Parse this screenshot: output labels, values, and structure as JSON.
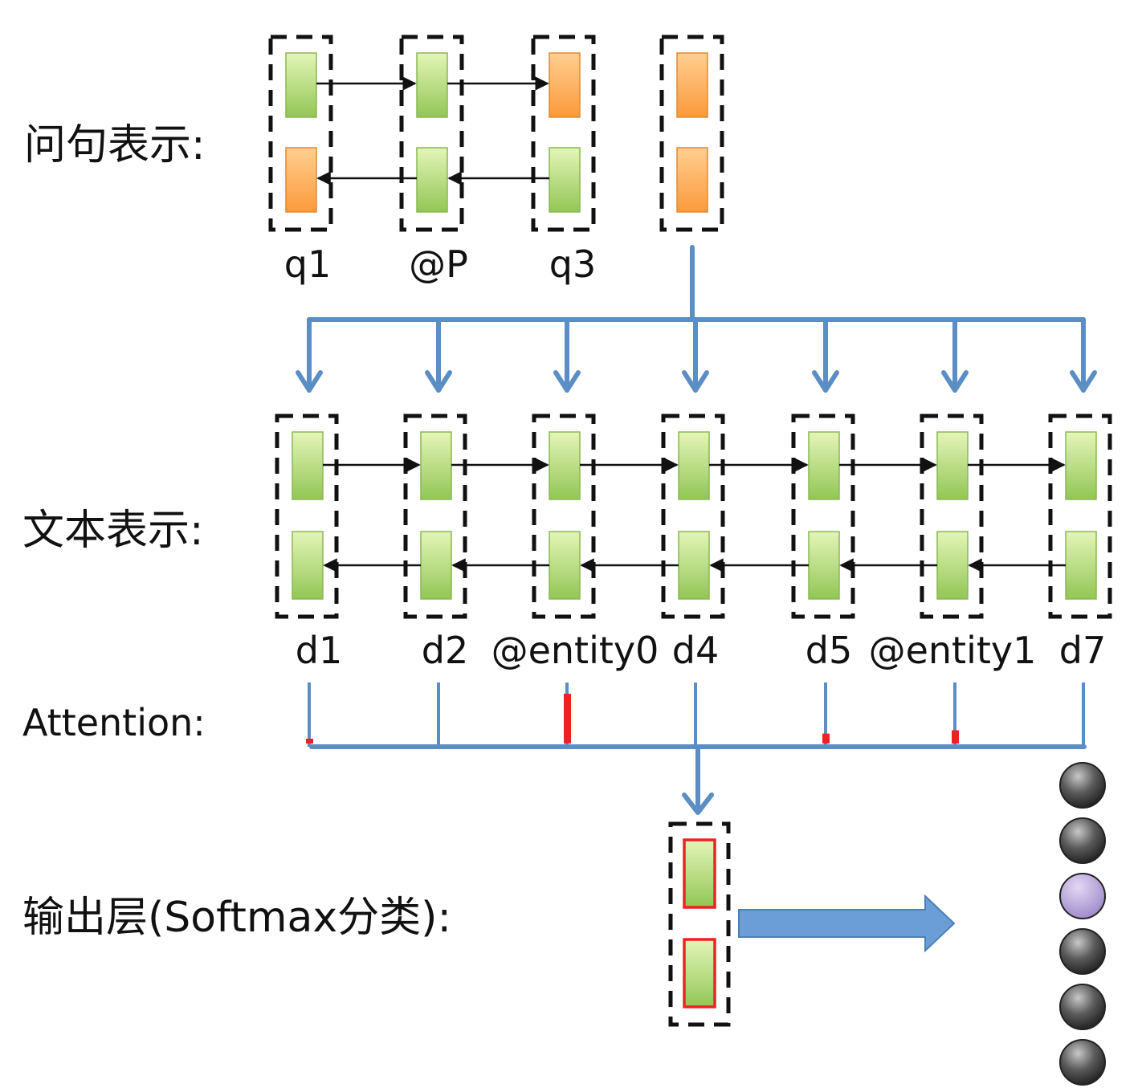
{
  "section_labels": {
    "question": "问句表示:",
    "document": "文本表示:",
    "attention": "Attention:",
    "output": "输出层(Softmax分类):"
  },
  "question_tokens": [
    "q1",
    "@P",
    "q3"
  ],
  "document_tokens": [
    "d1",
    "d2",
    "@entity0",
    "d4",
    "d5",
    "@entity1",
    "d7"
  ],
  "attention_weights": [
    0.02,
    0.0,
    0.75,
    0.0,
    0.15,
    0.2,
    0.0
  ],
  "output_classes": [
    {
      "state": "inactive"
    },
    {
      "state": "inactive"
    },
    {
      "state": "selected"
    },
    {
      "state": "inactive"
    },
    {
      "state": "inactive"
    },
    {
      "state": "inactive"
    }
  ],
  "colors": {
    "cell_green": "#a8d46a",
    "cell_orange": "#ff9e40",
    "connector_blue": "#5b8ec4",
    "attention_red": "#ee2222",
    "node_gray": "#555555",
    "node_selected": "#a48fd0",
    "dashed_border": "#111111"
  }
}
